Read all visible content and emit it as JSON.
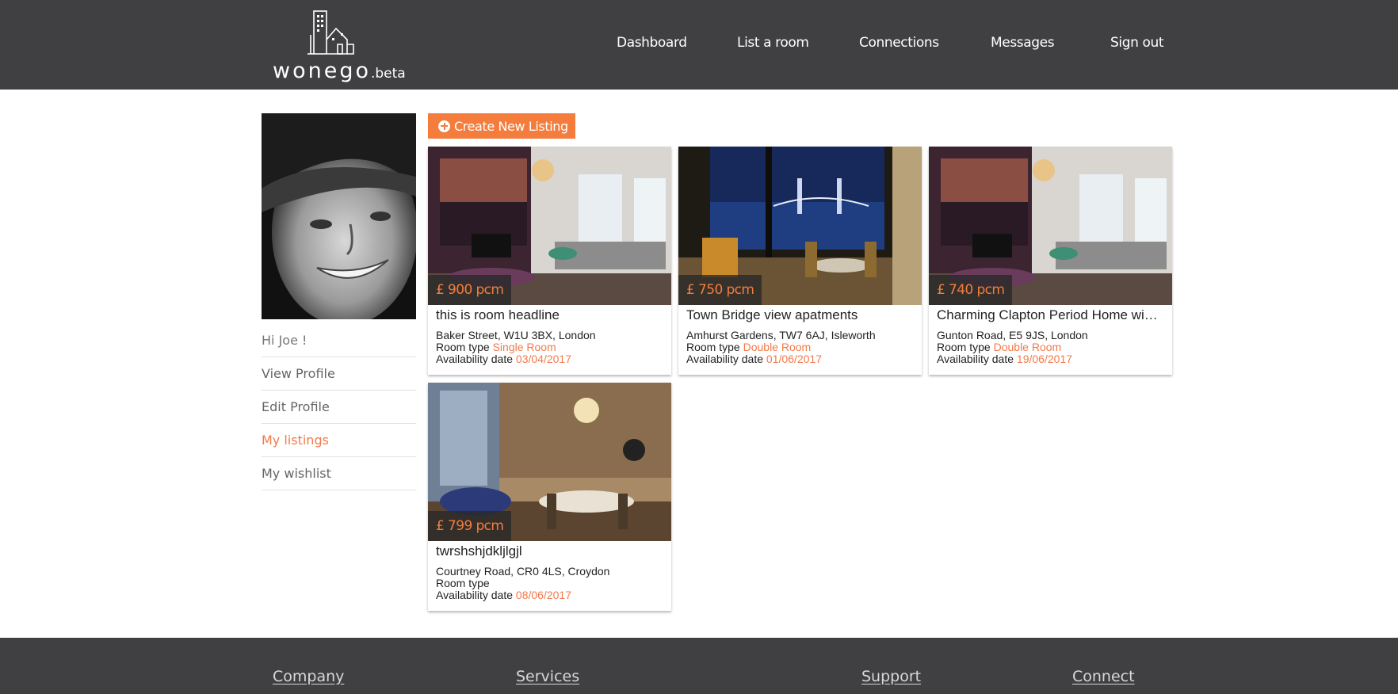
{
  "brand": {
    "name": "wonego",
    "suffix": ".beta"
  },
  "nav": [
    "Dashboard",
    "List a room",
    "Connections",
    "Messages",
    "Sign out"
  ],
  "sidebar": {
    "greeting": "Hi Joe !",
    "items": [
      "View Profile",
      "Edit Profile",
      "My listings",
      "My wishlist"
    ],
    "active": "My listings"
  },
  "create_button": "Create New Listing",
  "labels": {
    "room_type": "Room type",
    "availability": "Availability date"
  },
  "listings": [
    {
      "price": "£ 900 pcm",
      "title": "this is room headline",
      "address": "Baker Street, W1U 3BX, London",
      "room_type": "Single Room",
      "date": "03/04/2017",
      "image": "apartment-living-room"
    },
    {
      "price": "£ 750 pcm",
      "title": "Town Bridge view apatments",
      "address": "Amhurst Gardens, TW7 6AJ, Isleworth",
      "room_type": "Double Room",
      "date": "01/06/2017",
      "image": "tower-bridge-view"
    },
    {
      "price": "£ 740 pcm",
      "title": "Charming Clapton Period Home wi…",
      "address": "Gunton Road, E5 9JS, London",
      "room_type": "Double Room",
      "date": "19/06/2017",
      "image": "apartment-living-room"
    },
    {
      "price": "£ 799 pcm",
      "title": "twrshshjdkljlgjl",
      "address": "Courtney Road, CR0 4LS, Croydon",
      "room_type": "",
      "date": "08/06/2017",
      "image": "dining-room"
    }
  ],
  "footer": [
    "Company",
    "Services",
    "Support",
    "Connect"
  ],
  "colors": {
    "header_bg": "#404043",
    "accent": "#f47c3c"
  }
}
